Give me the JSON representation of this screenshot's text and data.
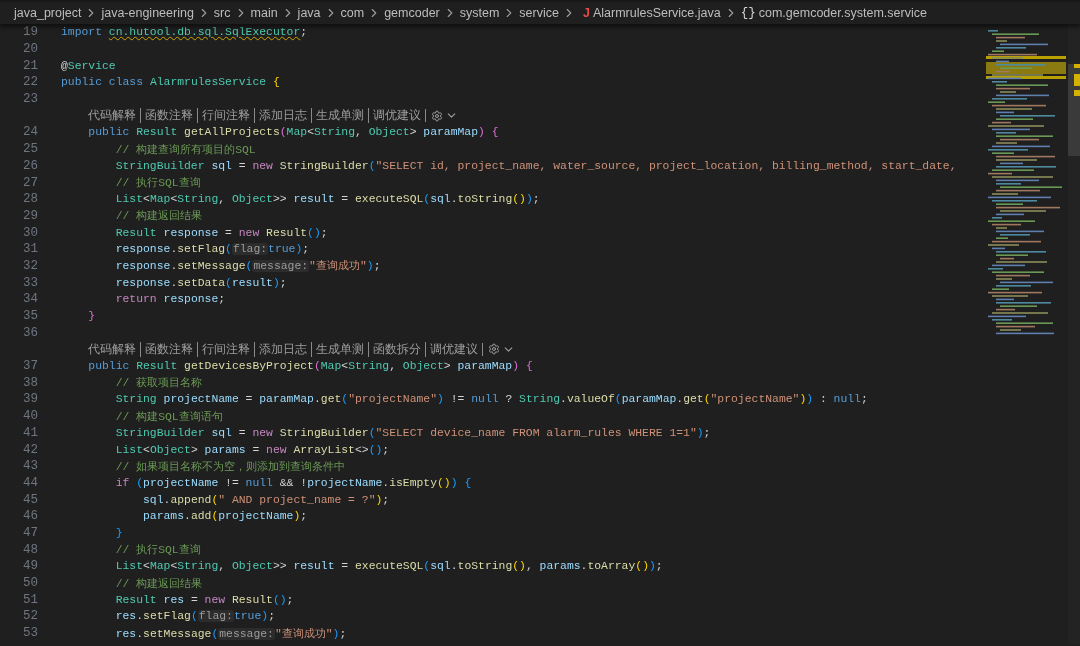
{
  "breadcrumb": [
    {
      "label": "java_project",
      "kind": "folder"
    },
    {
      "label": "java-engineering",
      "kind": "folder"
    },
    {
      "label": "src",
      "kind": "folder"
    },
    {
      "label": "main",
      "kind": "folder"
    },
    {
      "label": "java",
      "kind": "folder"
    },
    {
      "label": "com",
      "kind": "folder"
    },
    {
      "label": "gemcoder",
      "kind": "folder"
    },
    {
      "label": "system",
      "kind": "folder"
    },
    {
      "label": "service",
      "kind": "folder"
    },
    {
      "label": "AlarmrulesService.java",
      "kind": "file",
      "glyph": "J"
    },
    {
      "label": "com.gemcoder.system.service",
      "kind": "namespace",
      "glyph": "{}"
    }
  ],
  "editor": {
    "lines": [
      {
        "kind": "code",
        "number": "19",
        "tokens": [
          {
            "text": "import ",
            "kind": "kw"
          },
          {
            "text": "cn.hutool.db.sql.SqlExecutor",
            "kind": "warn"
          },
          {
            "text": ";",
            "kind": "p"
          }
        ]
      },
      {
        "kind": "code",
        "number": "20"
      },
      {
        "kind": "code",
        "number": "21",
        "tokens": [
          {
            "text": "@",
            "kind": "p"
          },
          {
            "text": "Service",
            "kind": "type"
          }
        ]
      },
      {
        "kind": "code",
        "number": "22",
        "tokens": [
          {
            "text": "public class ",
            "kind": "kw"
          },
          {
            "text": "AlarmrulesService ",
            "kind": "type"
          },
          {
            "text": "{",
            "kind": "b1"
          }
        ]
      },
      {
        "kind": "code",
        "number": "23"
      },
      {
        "kind": "lens",
        "actions": [
          "代码解释",
          "函数注释",
          "行间注释",
          "添加日志",
          "生成单测",
          "调优建议"
        ]
      },
      {
        "kind": "code",
        "number": "24",
        "tokens": [
          {
            "text": "    public ",
            "kind": "kw"
          },
          {
            "text": "Result ",
            "kind": "type"
          },
          {
            "text": "getAllProjects",
            "kind": "fn"
          },
          {
            "text": "(",
            "kind": "b2"
          },
          {
            "text": "Map",
            "kind": "type"
          },
          {
            "text": "<",
            "kind": "p"
          },
          {
            "text": "String",
            "kind": "type"
          },
          {
            "text": ", ",
            "kind": "p"
          },
          {
            "text": "Object",
            "kind": "type"
          },
          {
            "text": "> ",
            "kind": "p"
          },
          {
            "text": "paramMap",
            "kind": "var"
          },
          {
            "text": ") ",
            "kind": "b2"
          },
          {
            "text": "{",
            "kind": "b2"
          }
        ]
      },
      {
        "kind": "code",
        "number": "25",
        "tokens": [
          {
            "text": "        // 构建查询所有项目的SQL",
            "kind": "cm"
          }
        ]
      },
      {
        "kind": "code",
        "number": "26",
        "tokens": [
          {
            "text": "        StringBuilder ",
            "kind": "type"
          },
          {
            "text": "sql",
            "kind": "var"
          },
          {
            "text": " = ",
            "kind": "p"
          },
          {
            "text": "new ",
            "kind": "ctrl"
          },
          {
            "text": "StringBuilder",
            "kind": "fn"
          },
          {
            "text": "(",
            "kind": "b3"
          },
          {
            "text": "\"SELECT id, project_name, water_source, project_location, billing_method, start_date,",
            "kind": "str"
          }
        ]
      },
      {
        "kind": "code",
        "number": "27",
        "tokens": [
          {
            "text": "        // 执行SQL查询",
            "kind": "cm"
          }
        ]
      },
      {
        "kind": "code",
        "number": "28",
        "tokens": [
          {
            "text": "        List",
            "kind": "type"
          },
          {
            "text": "<",
            "kind": "p"
          },
          {
            "text": "Map",
            "kind": "type"
          },
          {
            "text": "<",
            "kind": "p"
          },
          {
            "text": "String",
            "kind": "type"
          },
          {
            "text": ", ",
            "kind": "p"
          },
          {
            "text": "Object",
            "kind": "type"
          },
          {
            "text": ">> ",
            "kind": "p"
          },
          {
            "text": "result",
            "kind": "var"
          },
          {
            "text": " = ",
            "kind": "p"
          },
          {
            "text": "executeSQL",
            "kind": "fn"
          },
          {
            "text": "(",
            "kind": "b3"
          },
          {
            "text": "sql",
            "kind": "var"
          },
          {
            "text": ".",
            "kind": "p"
          },
          {
            "text": "toString",
            "kind": "fn"
          },
          {
            "text": "()",
            "kind": "b1"
          },
          {
            "text": ")",
            "kind": "b3"
          },
          {
            "text": ";",
            "kind": "p"
          }
        ]
      },
      {
        "kind": "code",
        "number": "29",
        "tokens": [
          {
            "text": "        // 构建返回结果",
            "kind": "cm"
          }
        ]
      },
      {
        "kind": "code",
        "number": "30",
        "tokens": [
          {
            "text": "        Result ",
            "kind": "type"
          },
          {
            "text": "response",
            "kind": "var"
          },
          {
            "text": " = ",
            "kind": "p"
          },
          {
            "text": "new ",
            "kind": "ctrl"
          },
          {
            "text": "Result",
            "kind": "fn"
          },
          {
            "text": "()",
            "kind": "b3"
          },
          {
            "text": ";",
            "kind": "p"
          }
        ]
      },
      {
        "kind": "code",
        "number": "31",
        "tokens": [
          {
            "text": "        response",
            "kind": "var"
          },
          {
            "text": ".",
            "kind": "p"
          },
          {
            "text": "setFlag",
            "kind": "fn"
          },
          {
            "text": "(",
            "kind": "b3"
          },
          {
            "text": "flag:",
            "kind": "hint"
          },
          {
            "text": "true",
            "kind": "kw"
          },
          {
            "text": ")",
            "kind": "b3"
          },
          {
            "text": ";",
            "kind": "p"
          }
        ]
      },
      {
        "kind": "code",
        "number": "32",
        "tokens": [
          {
            "text": "        response",
            "kind": "var"
          },
          {
            "text": ".",
            "kind": "p"
          },
          {
            "text": "setMessage",
            "kind": "fn"
          },
          {
            "text": "(",
            "kind": "b3"
          },
          {
            "text": "message:",
            "kind": "hint"
          },
          {
            "text": "\"查询成功\"",
            "kind": "str"
          },
          {
            "text": ")",
            "kind": "b3"
          },
          {
            "text": ";",
            "kind": "p"
          }
        ]
      },
      {
        "kind": "code",
        "number": "33",
        "tokens": [
          {
            "text": "        response",
            "kind": "var"
          },
          {
            "text": ".",
            "kind": "p"
          },
          {
            "text": "setData",
            "kind": "fn"
          },
          {
            "text": "(",
            "kind": "b3"
          },
          {
            "text": "result",
            "kind": "var"
          },
          {
            "text": ")",
            "kind": "b3"
          },
          {
            "text": ";",
            "kind": "p"
          }
        ]
      },
      {
        "kind": "code",
        "number": "34",
        "tokens": [
          {
            "text": "        return ",
            "kind": "ctrl"
          },
          {
            "text": "response",
            "kind": "var"
          },
          {
            "text": ";",
            "kind": "p"
          }
        ]
      },
      {
        "kind": "code",
        "number": "35",
        "tokens": [
          {
            "text": "    }",
            "kind": "b2"
          }
        ]
      },
      {
        "kind": "code",
        "number": "36"
      },
      {
        "kind": "lens",
        "actions": [
          "代码解释",
          "函数注释",
          "行间注释",
          "添加日志",
          "生成单测",
          "函数拆分",
          "调优建议"
        ]
      },
      {
        "kind": "code",
        "number": "37",
        "tokens": [
          {
            "text": "    public ",
            "kind": "kw"
          },
          {
            "text": "Result ",
            "kind": "type"
          },
          {
            "text": "getDevicesByProject",
            "kind": "fn"
          },
          {
            "text": "(",
            "kind": "b2"
          },
          {
            "text": "Map",
            "kind": "type"
          },
          {
            "text": "<",
            "kind": "p"
          },
          {
            "text": "String",
            "kind": "type"
          },
          {
            "text": ", ",
            "kind": "p"
          },
          {
            "text": "Object",
            "kind": "type"
          },
          {
            "text": "> ",
            "kind": "p"
          },
          {
            "text": "paramMap",
            "kind": "var"
          },
          {
            "text": ") ",
            "kind": "b2"
          },
          {
            "text": "{",
            "kind": "b2"
          }
        ]
      },
      {
        "kind": "code",
        "number": "38",
        "tokens": [
          {
            "text": "        // 获取项目名称",
            "kind": "cm"
          }
        ]
      },
      {
        "kind": "code",
        "number": "39",
        "tokens": [
          {
            "text": "        String ",
            "kind": "type"
          },
          {
            "text": "projectName",
            "kind": "var"
          },
          {
            "text": " = ",
            "kind": "p"
          },
          {
            "text": "paramMap",
            "kind": "var"
          },
          {
            "text": ".",
            "kind": "p"
          },
          {
            "text": "get",
            "kind": "fn"
          },
          {
            "text": "(",
            "kind": "b3"
          },
          {
            "text": "\"projectName\"",
            "kind": "str"
          },
          {
            "text": ") ",
            "kind": "b3"
          },
          {
            "text": "!= ",
            "kind": "p"
          },
          {
            "text": "null ",
            "kind": "kw"
          },
          {
            "text": "? ",
            "kind": "p"
          },
          {
            "text": "String",
            "kind": "type"
          },
          {
            "text": ".",
            "kind": "p"
          },
          {
            "text": "valueOf",
            "kind": "fn"
          },
          {
            "text": "(",
            "kind": "b3"
          },
          {
            "text": "paramMap",
            "kind": "var"
          },
          {
            "text": ".",
            "kind": "p"
          },
          {
            "text": "get",
            "kind": "fn"
          },
          {
            "text": "(",
            "kind": "b1"
          },
          {
            "text": "\"projectName\"",
            "kind": "str"
          },
          {
            "text": ")",
            "kind": "b1"
          },
          {
            "text": ") ",
            "kind": "b3"
          },
          {
            "text": ": ",
            "kind": "p"
          },
          {
            "text": "null",
            "kind": "kw"
          },
          {
            "text": ";",
            "kind": "p"
          }
        ]
      },
      {
        "kind": "code",
        "number": "40",
        "tokens": [
          {
            "text": "        // 构建SQL查询语句",
            "kind": "cm"
          }
        ]
      },
      {
        "kind": "code",
        "number": "41",
        "tokens": [
          {
            "text": "        StringBuilder ",
            "kind": "type"
          },
          {
            "text": "sql",
            "kind": "var"
          },
          {
            "text": " = ",
            "kind": "p"
          },
          {
            "text": "new ",
            "kind": "ctrl"
          },
          {
            "text": "StringBuilder",
            "kind": "fn"
          },
          {
            "text": "(",
            "kind": "b3"
          },
          {
            "text": "\"SELECT device_name FROM alarm_rules WHERE 1=1\"",
            "kind": "str"
          },
          {
            "text": ")",
            "kind": "b3"
          },
          {
            "text": ";",
            "kind": "p"
          }
        ]
      },
      {
        "kind": "code",
        "number": "42",
        "tokens": [
          {
            "text": "        List",
            "kind": "type"
          },
          {
            "text": "<",
            "kind": "p"
          },
          {
            "text": "Object",
            "kind": "type"
          },
          {
            "text": "> ",
            "kind": "p"
          },
          {
            "text": "params",
            "kind": "var"
          },
          {
            "text": " = ",
            "kind": "p"
          },
          {
            "text": "new ",
            "kind": "ctrl"
          },
          {
            "text": "ArrayList",
            "kind": "fn"
          },
          {
            "text": "<>",
            "kind": "p"
          },
          {
            "text": "()",
            "kind": "b3"
          },
          {
            "text": ";",
            "kind": "p"
          }
        ]
      },
      {
        "kind": "code",
        "number": "43",
        "tokens": [
          {
            "text": "        // 如果项目名称不为空，则添加到查询条件中",
            "kind": "cm"
          }
        ]
      },
      {
        "kind": "code",
        "number": "44",
        "tokens": [
          {
            "text": "        if ",
            "kind": "ctrl"
          },
          {
            "text": "(",
            "kind": "b3"
          },
          {
            "text": "projectName",
            "kind": "var"
          },
          {
            "text": " != ",
            "kind": "p"
          },
          {
            "text": "null ",
            "kind": "kw"
          },
          {
            "text": "&& !",
            "kind": "p"
          },
          {
            "text": "projectName",
            "kind": "var"
          },
          {
            "text": ".",
            "kind": "p"
          },
          {
            "text": "isEmpty",
            "kind": "fn"
          },
          {
            "text": "()",
            "kind": "b1"
          },
          {
            "text": ") ",
            "kind": "b3"
          },
          {
            "text": "{",
            "kind": "b3"
          }
        ]
      },
      {
        "kind": "code",
        "number": "45",
        "tokens": [
          {
            "text": "            sql",
            "kind": "var"
          },
          {
            "text": ".",
            "kind": "p"
          },
          {
            "text": "append",
            "kind": "fn"
          },
          {
            "text": "(",
            "kind": "b1"
          },
          {
            "text": "\" AND project_name = ?\"",
            "kind": "str"
          },
          {
            "text": ")",
            "kind": "b1"
          },
          {
            "text": ";",
            "kind": "p"
          }
        ]
      },
      {
        "kind": "code",
        "number": "46",
        "tokens": [
          {
            "text": "            params",
            "kind": "var"
          },
          {
            "text": ".",
            "kind": "p"
          },
          {
            "text": "add",
            "kind": "fn"
          },
          {
            "text": "(",
            "kind": "b1"
          },
          {
            "text": "projectName",
            "kind": "var"
          },
          {
            "text": ")",
            "kind": "b1"
          },
          {
            "text": ";",
            "kind": "p"
          }
        ]
      },
      {
        "kind": "code",
        "number": "47",
        "tokens": [
          {
            "text": "        }",
            "kind": "b3"
          }
        ]
      },
      {
        "kind": "code",
        "number": "48",
        "tokens": [
          {
            "text": "        // 执行SQL查询",
            "kind": "cm"
          }
        ]
      },
      {
        "kind": "code",
        "number": "49",
        "tokens": [
          {
            "text": "        List",
            "kind": "type"
          },
          {
            "text": "<",
            "kind": "p"
          },
          {
            "text": "Map",
            "kind": "type"
          },
          {
            "text": "<",
            "kind": "p"
          },
          {
            "text": "String",
            "kind": "type"
          },
          {
            "text": ", ",
            "kind": "p"
          },
          {
            "text": "Object",
            "kind": "type"
          },
          {
            "text": ">> ",
            "kind": "p"
          },
          {
            "text": "result",
            "kind": "var"
          },
          {
            "text": " = ",
            "kind": "p"
          },
          {
            "text": "executeSQL",
            "kind": "fn"
          },
          {
            "text": "(",
            "kind": "b3"
          },
          {
            "text": "sql",
            "kind": "var"
          },
          {
            "text": ".",
            "kind": "p"
          },
          {
            "text": "toString",
            "kind": "fn"
          },
          {
            "text": "()",
            "kind": "b1"
          },
          {
            "text": ", ",
            "kind": "p"
          },
          {
            "text": "params",
            "kind": "var"
          },
          {
            "text": ".",
            "kind": "p"
          },
          {
            "text": "toArray",
            "kind": "fn"
          },
          {
            "text": "()",
            "kind": "b1"
          },
          {
            "text": ")",
            "kind": "b3"
          },
          {
            "text": ";",
            "kind": "p"
          }
        ]
      },
      {
        "kind": "code",
        "number": "50",
        "tokens": [
          {
            "text": "        // 构建返回结果",
            "kind": "cm"
          }
        ]
      },
      {
        "kind": "code",
        "number": "51",
        "tokens": [
          {
            "text": "        Result ",
            "kind": "type"
          },
          {
            "text": "res",
            "kind": "var"
          },
          {
            "text": " = ",
            "kind": "p"
          },
          {
            "text": "new ",
            "kind": "ctrl"
          },
          {
            "text": "Result",
            "kind": "fn"
          },
          {
            "text": "()",
            "kind": "b3"
          },
          {
            "text": ";",
            "kind": "p"
          }
        ]
      },
      {
        "kind": "code",
        "number": "52",
        "tokens": [
          {
            "text": "        res",
            "kind": "var"
          },
          {
            "text": ".",
            "kind": "p"
          },
          {
            "text": "setFlag",
            "kind": "fn"
          },
          {
            "text": "(",
            "kind": "b3"
          },
          {
            "text": "flag:",
            "kind": "hint"
          },
          {
            "text": "true",
            "kind": "kw"
          },
          {
            "text": ")",
            "kind": "b3"
          },
          {
            "text": ";",
            "kind": "p"
          }
        ]
      },
      {
        "kind": "code",
        "number": "53",
        "tokens": [
          {
            "text": "        res",
            "kind": "var"
          },
          {
            "text": ".",
            "kind": "p"
          },
          {
            "text": "setMessage",
            "kind": "fn"
          },
          {
            "text": "(",
            "kind": "b3"
          },
          {
            "text": "message:",
            "kind": "hint"
          },
          {
            "text": "\"查询成功\"",
            "kind": "str"
          },
          {
            "text": ")",
            "kind": "b3"
          },
          {
            "text": ";",
            "kind": "p"
          }
        ]
      }
    ]
  }
}
